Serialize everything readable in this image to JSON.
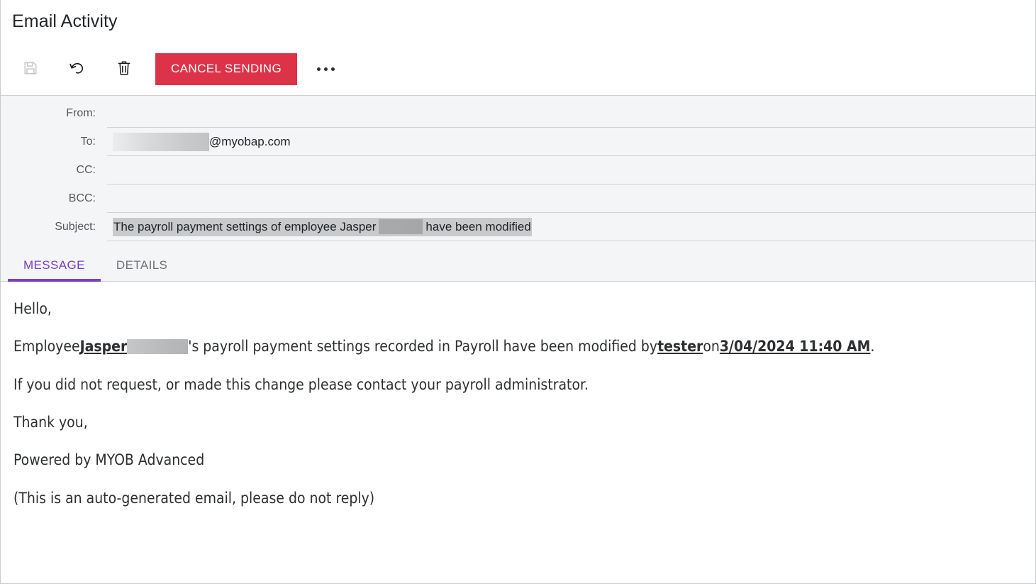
{
  "window": {
    "title": "Email Activity"
  },
  "toolbar": {
    "save_label": "save-icon",
    "undo_label": "undo-icon",
    "delete_label": "trash-icon",
    "cancel_sending_label": "CANCEL SENDING",
    "more_label": "…",
    "accent_red": "#dd3349"
  },
  "fields": [
    {
      "label": "From:",
      "value": ""
    },
    {
      "label": "To:",
      "value": "@myobap.com",
      "redacted": true
    },
    {
      "label": "CC:",
      "value": ""
    },
    {
      "label": "BCC:",
      "value": ""
    },
    {
      "label": "Subject:",
      "value_prefix": "The payroll payment settings of employee Jasper",
      "value_suffix": "have been modified",
      "redacted": true,
      "highlighted": true
    }
  ],
  "tabs": [
    {
      "label": "MESSAGE",
      "active": true
    },
    {
      "label": "DETAILS",
      "active": false
    }
  ],
  "tab_accent": "#7b3fbf",
  "message": {
    "greeting": "Hello,",
    "line2_a": "Employee ",
    "line2_name": "Jasper",
    "line2_b": "'s payroll payment settings recorded in Payroll have been modified by ",
    "line2_user": "tester",
    "line2_c": " on ",
    "line2_date": "3/04/2024 11:40 AM",
    "line2_d": ".",
    "line3": "If you did not request, or made this change please contact your payroll administrator.",
    "line4": "Thank you,",
    "line5": "Powered by MYOB Advanced",
    "line6": "(This is an auto-generated email, please do not reply)"
  }
}
